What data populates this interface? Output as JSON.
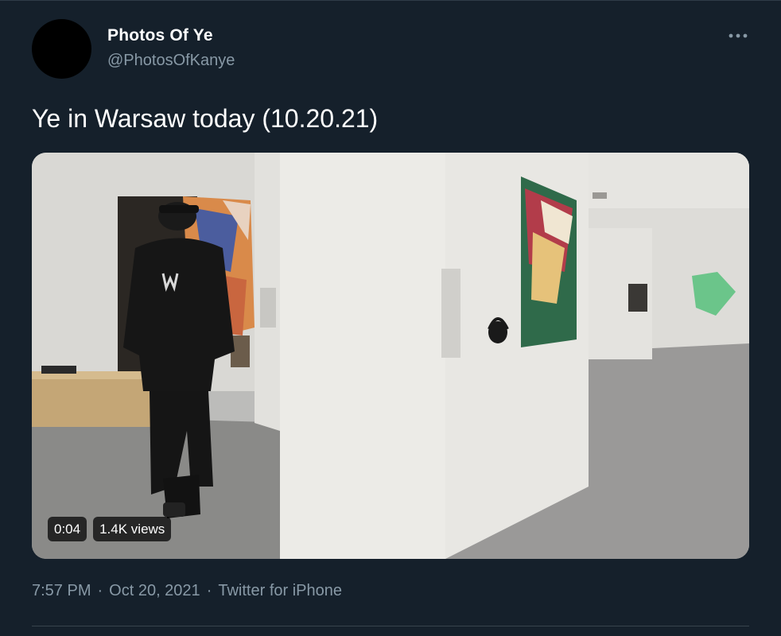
{
  "tweet": {
    "author": {
      "display_name": "Photos Of Ye",
      "handle": "@PhotosOfKanye"
    },
    "text": "Ye in Warsaw today (10.20.21)",
    "more_icon": "more-horizontal-icon",
    "media": {
      "type": "video",
      "timestamp": "0:04",
      "views": "1.4K views",
      "description_icon": "video-thumbnail"
    },
    "time": "7:57 PM",
    "separator": "·",
    "date": "Oct 20, 2021",
    "source": "Twitter for iPhone"
  },
  "colors": {
    "background": "#15202b",
    "primary_text": "#ffffff",
    "secondary_text": "#8899a6"
  }
}
